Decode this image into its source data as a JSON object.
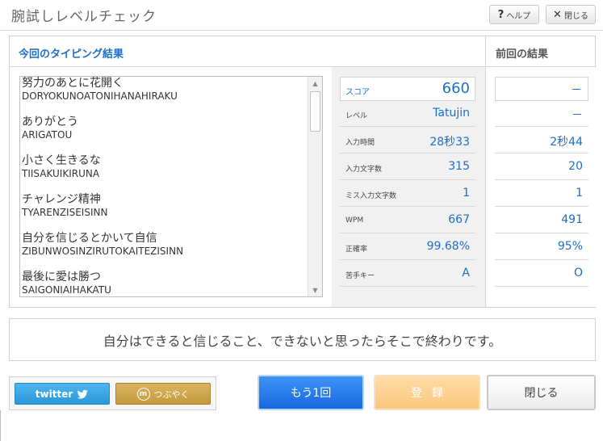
{
  "window": {
    "title": "腕試しレベルチェック",
    "help_label": "ヘルプ",
    "help_icon": "?",
    "close_label": "閉じる",
    "close_icon": "✕"
  },
  "results": {
    "header": "今回のタイピング結果",
    "prev_header": "前回の結果",
    "words": [
      {
        "jp": "努力のあとに花開く",
        "romaji": "DORYOKUNOATONIHANAHIRAKU"
      },
      {
        "jp": "ありがとう",
        "romaji": "ARIGATOU"
      },
      {
        "jp": "小さく生きるな",
        "romaji": "TIISAKUIKIRUNA"
      },
      {
        "jp": "チャレンジ精神",
        "romaji": "TYARENZISEISINN"
      },
      {
        "jp": "自分を信じるとかいて自信",
        "romaji": "ZIBUNWOSINZIRUTOKAITEZISINN"
      },
      {
        "jp": "最後に愛は勝つ",
        "romaji": "SAIGONIAIHAKATU"
      }
    ],
    "stats": [
      {
        "label": "スコア",
        "current": "660",
        "previous": "－"
      },
      {
        "label": "レベル",
        "current": "Tatujin",
        "previous": "－"
      },
      {
        "label": "入力時間",
        "current": "28秒33",
        "previous": "2秒44"
      },
      {
        "label": "入力文字数",
        "current": "315",
        "previous": "20"
      },
      {
        "label": "ミス入力文字数",
        "current": "1",
        "previous": "1"
      },
      {
        "label": "WPM",
        "current": "667",
        "previous": "491"
      },
      {
        "label": "正確率",
        "current": "99.68%",
        "previous": "95%"
      },
      {
        "label": "苦手キー",
        "current": "A",
        "previous": "O"
      }
    ]
  },
  "message": "自分はできると信じること、できないと思ったらそこで終わりです。",
  "social": {
    "twitter_label": "twitter",
    "tsubuyaku_label": "つぶやく",
    "tsubuyaku_icon": "m"
  },
  "actions": {
    "again_label": "もう1回",
    "register_label": "登録",
    "close_label": "閉じる"
  },
  "colors": {
    "accent": "#1b6fc8",
    "again_button": "#2a7ff0",
    "register_button": "#fdd092",
    "twitter": "#3aa7e8",
    "tsubuyaku": "#c9a24a"
  }
}
